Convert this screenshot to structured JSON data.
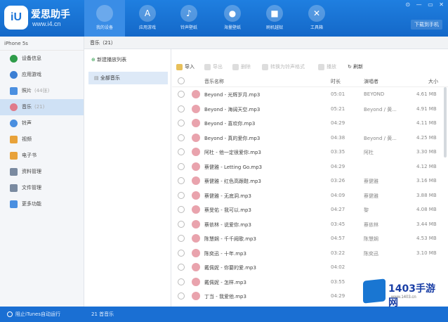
{
  "brand": {
    "title": "爱思助手",
    "url": "www.i4.cn"
  },
  "nav_tabs": [
    {
      "label": "我的设备",
      "icon": "apple-icon"
    },
    {
      "label": "应用游戏",
      "icon": "app-store-icon"
    },
    {
      "label": "铃声壁纸",
      "icon": "bell-icon"
    },
    {
      "label": "海量壁纸",
      "icon": "wallpaper-icon"
    },
    {
      "label": "刷机越狱",
      "icon": "box-icon"
    },
    {
      "label": "工具箱",
      "icon": "tools-icon"
    }
  ],
  "window_controls": [
    "⊙",
    "—",
    "▭",
    "✕"
  ],
  "phone_link": "下载到手机",
  "device": {
    "name": "iPhone 5s"
  },
  "sidebar": {
    "items": [
      {
        "label": "设备信息",
        "count": "",
        "color": "#2e9c4a"
      },
      {
        "label": "应用游戏",
        "count": "",
        "color": "#3b7fd4"
      },
      {
        "label": "照片",
        "count": "(44张)",
        "color": "#4a8fe0"
      },
      {
        "label": "音乐",
        "count": "(21)",
        "color": "#e07a8a"
      },
      {
        "label": "铃声",
        "count": "",
        "color": "#4a8fe0"
      },
      {
        "label": "视频",
        "count": "",
        "color": "#e8a23a"
      },
      {
        "label": "电子书",
        "count": "",
        "color": "#e8a23a"
      },
      {
        "label": "资料管理",
        "count": "",
        "color": "#7a8aa0"
      },
      {
        "label": "文件管理",
        "count": "",
        "color": "#7a8aa0"
      },
      {
        "label": "更多功能",
        "count": "",
        "color": "#4a8fe0"
      }
    ]
  },
  "tab": {
    "label": "音乐（21）"
  },
  "playlist": {
    "new_label": "新建播放列表",
    "all_label": "全部音乐"
  },
  "toolbar": {
    "import": "导入",
    "export": "导出",
    "delete": "删除",
    "convert": "转换为铃声格式",
    "play": "播放",
    "refresh": "刷新"
  },
  "table": {
    "headers": {
      "name": "音乐名称",
      "time": "时长",
      "artist": "演唱者",
      "size": "大小"
    },
    "rows": [
      {
        "name": "Beyond - 光辉岁月.mp3",
        "time": "05:01",
        "artist": "BEYOND",
        "size": "4.61 MB"
      },
      {
        "name": "Beyond - 海阔天空.mp3",
        "time": "05:21",
        "artist": "Beyond / 黄...",
        "size": "4.91 MB"
      },
      {
        "name": "Beyond - 喜欢你.mp3",
        "time": "04:29",
        "artist": "",
        "size": "4.11 MB"
      },
      {
        "name": "Beyond - 真的爱你.mp3",
        "time": "04:38",
        "artist": "Beyond / 黄...",
        "size": "4.25 MB"
      },
      {
        "name": "阿杜 - 他一定很爱你.mp3",
        "time": "03:35",
        "artist": "阿杜",
        "size": "3.30 MB"
      },
      {
        "name": "蔡健雅 - Letting Go.mp3",
        "time": "04:29",
        "artist": "",
        "size": "4.12 MB"
      },
      {
        "name": "蔡健雅 - 红色高跟鞋.mp3",
        "time": "03:26",
        "artist": "蔡健雅",
        "size": "3.16 MB"
      },
      {
        "name": "蔡健雅 - 无底洞.mp3",
        "time": "04:09",
        "artist": "蔡健雅",
        "size": "3.88 MB"
      },
      {
        "name": "蔡旻佑 - 我可以.mp3",
        "time": "04:27",
        "artist": "黎",
        "size": "4.08 MB"
      },
      {
        "name": "蔡依林 - 说爱你.mp3",
        "time": "03:45",
        "artist": "蔡依林",
        "size": "3.44 MB"
      },
      {
        "name": "陈慧娴 - 千千阙歌.mp3",
        "time": "04:57",
        "artist": "陈慧娴",
        "size": "4.53 MB"
      },
      {
        "name": "陈奕迅 - 十年.mp3",
        "time": "03:22",
        "artist": "陈奕迅",
        "size": "3.10 MB"
      },
      {
        "name": "戴佩妮 - 你要的爱.mp3",
        "time": "04:02",
        "artist": "",
        "size": ""
      },
      {
        "name": "戴佩妮 - 怎样.mp3",
        "time": "03:55",
        "artist": "",
        "size": ""
      },
      {
        "name": "丁当 - 我爱他.mp3",
        "time": "04:29",
        "artist": "",
        "size": ""
      }
    ]
  },
  "status": {
    "itunes_toggle": "阻止iTunes自动运行",
    "song_count": "21 首音乐"
  },
  "watermark": {
    "text": "1403手游网",
    "url": "www.1403.cn"
  },
  "colors": {
    "primary": "#1a6fd3",
    "selected_row": "#dde9f7",
    "song_icon": "#e9a3ad"
  }
}
